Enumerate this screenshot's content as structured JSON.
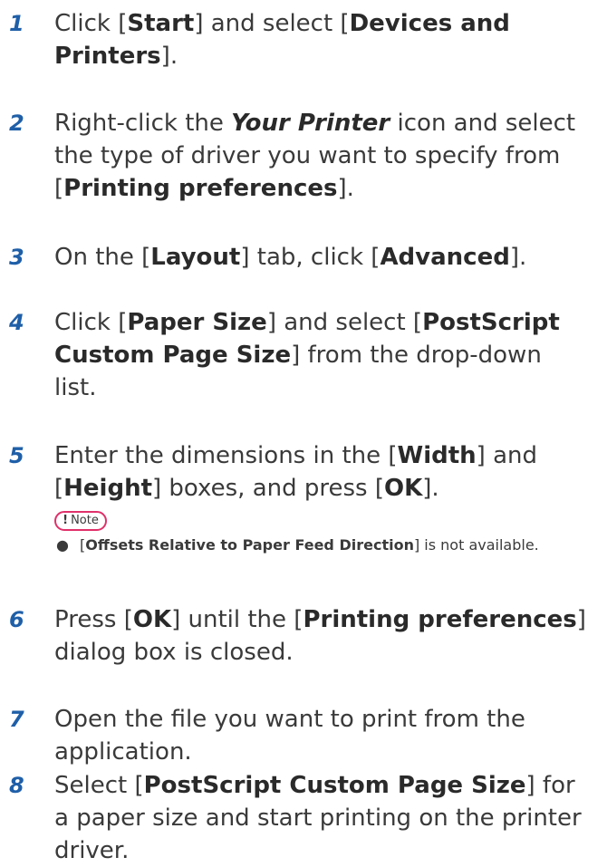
{
  "steps": [
    {
      "number": "1",
      "parts": [
        {
          "t": "Click ["
        },
        {
          "t": "Start",
          "b": true
        },
        {
          "t": "] and select ["
        },
        {
          "t": "Devices and Printers",
          "b": true
        },
        {
          "t": "]."
        }
      ]
    },
    {
      "number": "2",
      "parts": [
        {
          "t": "Right-click the "
        },
        {
          "t": "Your Printer",
          "b": true,
          "i": true
        },
        {
          "t": " icon and select the type of driver you want to specify from ["
        },
        {
          "t": "Printing preferences",
          "b": true
        },
        {
          "t": "]."
        }
      ]
    },
    {
      "number": "3",
      "parts": [
        {
          "t": "On the ["
        },
        {
          "t": "Layout",
          "b": true
        },
        {
          "t": "] tab, click ["
        },
        {
          "t": "Advanced",
          "b": true
        },
        {
          "t": "]."
        }
      ]
    },
    {
      "number": "4",
      "parts": [
        {
          "t": "Click ["
        },
        {
          "t": "Paper Size",
          "b": true
        },
        {
          "t": "] and select ["
        },
        {
          "t": "PostScript Custom Page Size",
          "b": true
        },
        {
          "t": "] from the drop-down list."
        }
      ]
    },
    {
      "number": "5",
      "parts": [
        {
          "t": "Enter the dimensions in the ["
        },
        {
          "t": "Width",
          "b": true
        },
        {
          "t": "] and ["
        },
        {
          "t": "Height",
          "b": true
        },
        {
          "t": "] boxes, and press ["
        },
        {
          "t": "OK",
          "b": true
        },
        {
          "t": "]."
        }
      ]
    },
    {
      "number": "6",
      "parts": [
        {
          "t": "Press ["
        },
        {
          "t": "OK",
          "b": true
        },
        {
          "t": "] until the ["
        },
        {
          "t": "Printing preferences",
          "b": true
        },
        {
          "t": "] dialog box is closed."
        }
      ]
    },
    {
      "number": "7",
      "parts": [
        {
          "t": "Open the file you want to print from the application."
        }
      ]
    },
    {
      "number": "8",
      "parts": [
        {
          "t": "Select ["
        },
        {
          "t": "PostScript Custom Page Size",
          "b": true
        },
        {
          "t": "] for a paper size and start printing on the printer driver."
        }
      ]
    }
  ],
  "note": {
    "badge_symbol": "!",
    "badge_label": "Note",
    "bullet": "●",
    "parts": [
      {
        "t": "["
      },
      {
        "t": "Offsets Relative to Paper Feed Direction",
        "b": true
      },
      {
        "t": "] is not available."
      }
    ]
  }
}
